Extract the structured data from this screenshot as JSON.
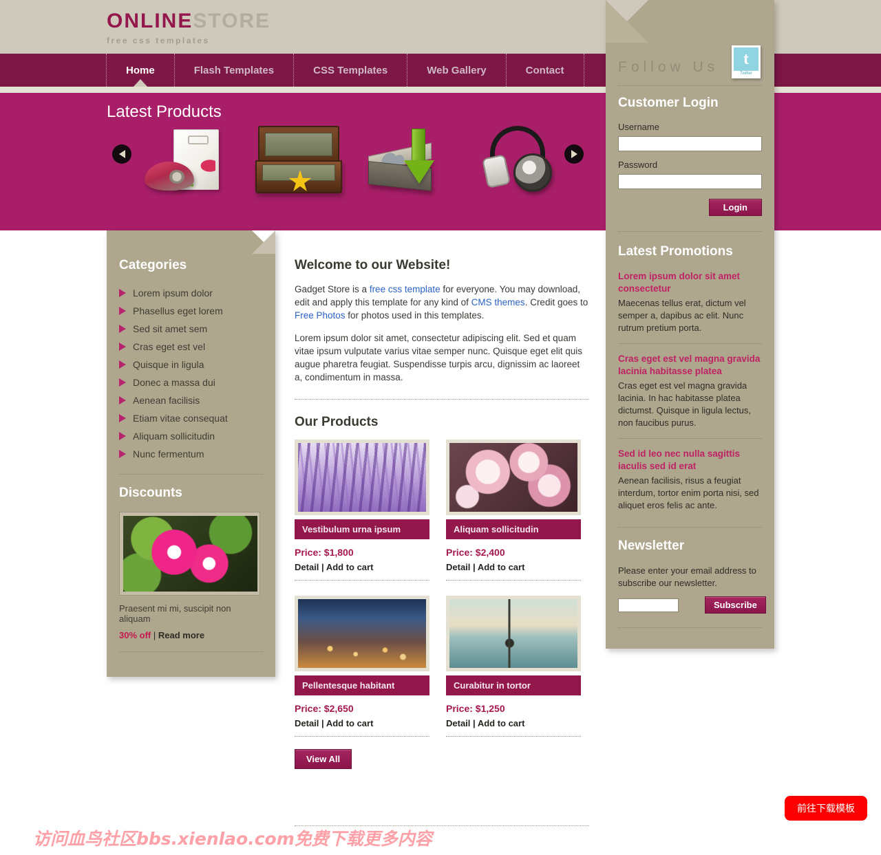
{
  "header": {
    "logo_primary": "ONLINE",
    "logo_secondary": "STORE",
    "logo_tagline": "free css templates"
  },
  "nav": {
    "items": [
      {
        "label": "Home",
        "active": true
      },
      {
        "label": "Flash Templates",
        "active": false
      },
      {
        "label": "CSS Templates",
        "active": false
      },
      {
        "label": "Web Gallery",
        "active": false
      },
      {
        "label": "Contact",
        "active": false
      }
    ]
  },
  "hero": {
    "title": "Latest Products",
    "prev_icon": "arrow-left-icon",
    "next_icon": "arrow-right-icon"
  },
  "left_sidebar": {
    "categories_heading": "Categories",
    "categories": [
      "Lorem ipsum dolor",
      "Phasellus eget lorem",
      "Sed sit amet sem",
      "Cras eget est vel",
      "Quisque in ligula",
      "Donec a massa dui",
      "Aenean facilisis",
      "Etiam vitae consequat",
      "Aliquam sollicitudin",
      "Nunc fermentum"
    ],
    "discounts_heading": "Discounts",
    "discount_caption": "Praesent mi mi, suscipit non aliquam",
    "discount_percent": "30% off",
    "discount_divider": "|",
    "discount_read_more": "Read more"
  },
  "main": {
    "welcome_heading": "Welcome to our Website!",
    "welcome_p1_a": "Gadget Store is a ",
    "welcome_link1": "free css template",
    "welcome_p1_b": " for everyone. You may download, edit and apply this template for any kind of ",
    "welcome_link2": "CMS themes",
    "welcome_p1_c": ". Credit goes to ",
    "welcome_link3": "Free Photos",
    "welcome_p1_d": " for photos used in this templates.",
    "welcome_p2": "Lorem ipsum dolor sit amet, consectetur adipiscing elit. Sed et quam vitae ipsum vulputate varius vitae semper nunc. Quisque eget elit quis augue pharetra feugiat. Suspendisse turpis arcu, dignissim ac laoreet a, condimentum in massa.",
    "products_heading": "Our Products",
    "detail_label": "Detail",
    "links_divider": "|",
    "cart_label": "Add to cart",
    "view_all_label": "View All",
    "products": [
      {
        "title": "Vestibulum urna ipsum",
        "price": "Price: $1,800"
      },
      {
        "title": "Aliquam sollicitudin",
        "price": "Price: $2,400"
      },
      {
        "title": "Pellentesque habitant",
        "price": "Price: $2,650"
      },
      {
        "title": "Curabitur in tortor",
        "price": "Price: $1,250"
      }
    ]
  },
  "right_sidebar": {
    "follow_us_heading": "Follow Us",
    "twitter_glyph": "t",
    "twitter_label": "Twitter",
    "login_heading": "Customer Login",
    "username_label": "Username",
    "username_value": "",
    "password_label": "Password",
    "password_value": "",
    "login_button": "Login",
    "promotions_heading": "Latest Promotions",
    "promotions": [
      {
        "title": "Lorem ipsum dolor sit amet consectetur",
        "body": "Maecenas tellus erat, dictum vel semper a, dapibus ac elit. Nunc rutrum pretium porta."
      },
      {
        "title": "Cras eget est vel magna gravida lacinia habitasse platea",
        "body": "Cras eget est vel magna gravida lacinia. In hac habitasse platea dictumst. Quisque in ligula lectus, non faucibus purus."
      },
      {
        "title": "Sed id leo nec nulla sagittis iaculis sed id erat",
        "body": "Aenean facilisis, risus a feugiat interdum, tortor enim porta nisi, sed aliquet eros felis ac ante."
      }
    ],
    "newsletter_heading": "Newsletter",
    "newsletter_text": "Please enter your email address to subscribe our newsletter.",
    "newsletter_value": "",
    "subscribe_button": "Subscribe"
  },
  "overlay": {
    "watermark": "访问血鸟社区bbs.xienlao.com免费下载更多内容",
    "download_button": "前往下载模板"
  },
  "colors": {
    "plum_nav": "#7d1745",
    "magenta_hero": "#a81e68",
    "tan_panel": "#afa68e",
    "header_strip": "#cfc9bb",
    "accent_pink": "#bf2263",
    "link_blue": "#2b62c4",
    "download_red": "#fb0000"
  }
}
